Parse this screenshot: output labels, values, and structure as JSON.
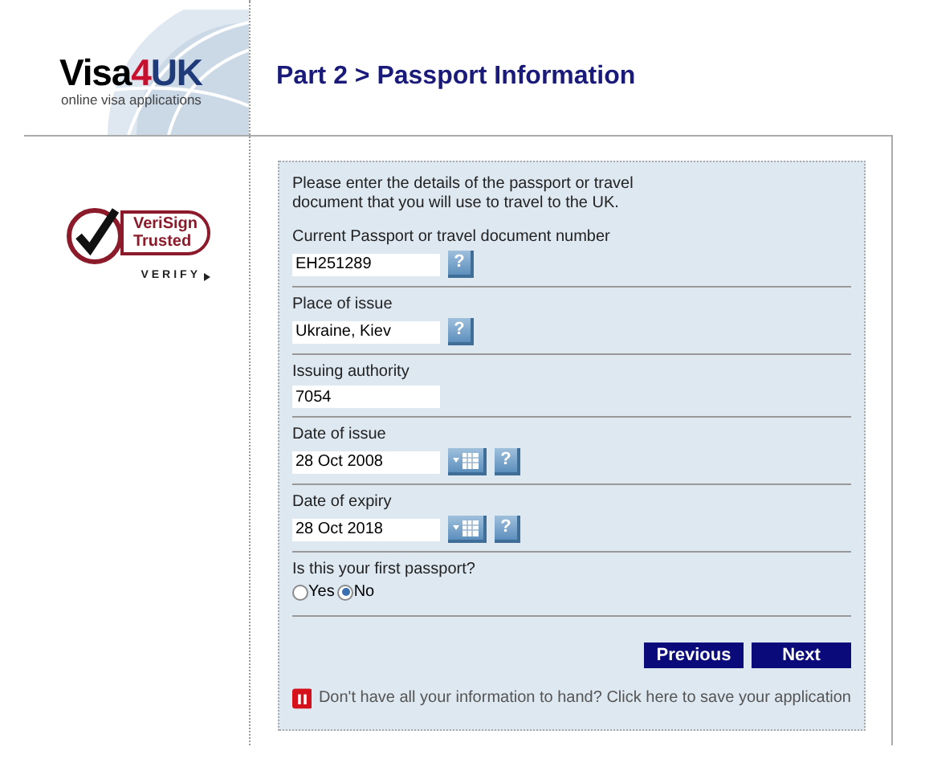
{
  "logo": {
    "brand_prefix": "Visa",
    "brand_number": "4",
    "brand_suffix": "UK",
    "tagline": "online visa applications"
  },
  "page_title": "Part 2 > Passport Information",
  "trust_badge": {
    "line_1": "VeriSign",
    "line_2": "Trusted",
    "link": "VERIFY"
  },
  "intro": "Please enter the details of the passport or travel document that you will use to travel to the UK.",
  "fields": [
    {
      "kind": "text",
      "label": "Current Passport or travel document number",
      "value": "EH251289",
      "help": "?"
    },
    {
      "kind": "text",
      "label": "Place of issue",
      "value": "Ukraine, Kiev",
      "help": "?"
    },
    {
      "kind": "text",
      "label": "Issuing authority",
      "value": "7054"
    },
    {
      "kind": "date",
      "label": "Date of issue",
      "value": "28 Oct 2008",
      "help": "?"
    },
    {
      "kind": "date",
      "label": "Date of expiry",
      "value": "28 Oct 2018",
      "help": "?"
    },
    {
      "kind": "radio",
      "label": "Is this your first passport?",
      "options": [
        {
          "label": "Yes",
          "selected": false
        },
        {
          "label": "No",
          "selected": true
        }
      ]
    }
  ],
  "buttons": [
    "Previous",
    "Next"
  ],
  "save_notice": "Don't have all your information to hand? Click here to save your application"
}
